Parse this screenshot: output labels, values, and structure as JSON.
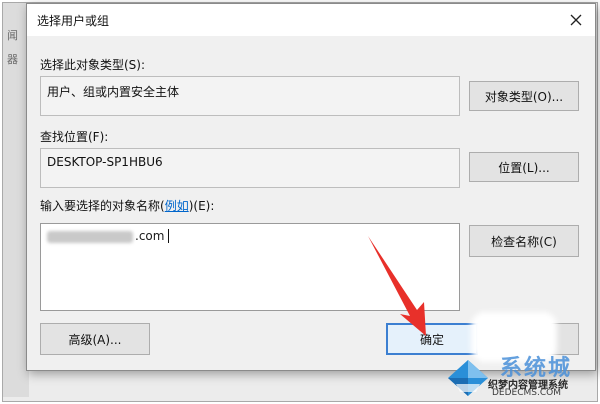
{
  "dialog": {
    "title": "选择用户或组",
    "object_type": {
      "label": "选择此对象类型(S):",
      "value": "用户、组或内置安全主体",
      "button": "对象类型(O)..."
    },
    "location": {
      "label": "查找位置(F):",
      "value": "DESKTOP-SP1HBU6",
      "button": "位置(L)..."
    },
    "names": {
      "label_prefix": "输入要选择的对象名称(",
      "label_link": "例如",
      "label_suffix": ")(E):",
      "value_suffix": ".com",
      "check_button": "检查名称(C)"
    },
    "buttons": {
      "advanced": "高级(A)...",
      "ok": "确定"
    }
  },
  "background": {
    "chars": [
      "闻",
      "器"
    ]
  },
  "watermark": {
    "main": "系统城",
    "sub": "织梦内容管理系统",
    "url": "DEDECMS.COM"
  },
  "colors": {
    "accent": "#3c7fd1",
    "arrow": "#e8302a",
    "watermark": "#4a90d9"
  }
}
